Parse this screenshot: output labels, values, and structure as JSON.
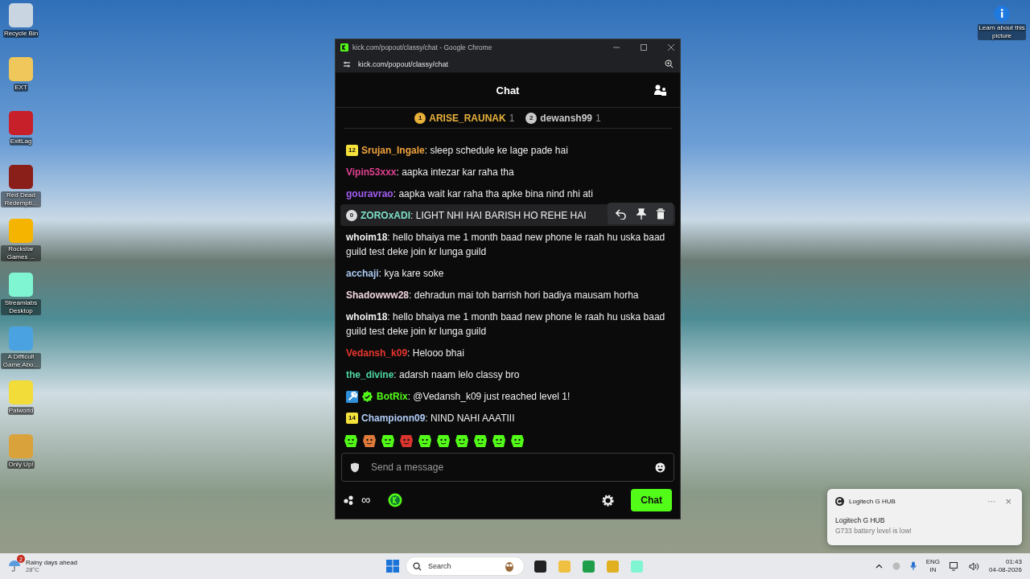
{
  "desktop_icons": [
    {
      "label": "Recycle Bin",
      "color": "#c9d6e2"
    },
    {
      "label": "EXT",
      "color": "#f0c75a"
    },
    {
      "label": "ExitLag",
      "color": "#c8202a"
    },
    {
      "label": "Red Dead Redempti...",
      "color": "#8a1f1a"
    },
    {
      "label": "Rockstar Games ...",
      "color": "#f5b400"
    },
    {
      "label": "Streamlabs Desktop",
      "color": "#80f5d2"
    },
    {
      "label": "A Difficult Game Abo...",
      "color": "#4aa3e0"
    },
    {
      "label": "Palworld",
      "color": "#f2dc3a"
    },
    {
      "label": "Only Up!",
      "color": "#d9a23a"
    }
  ],
  "learn_picture": {
    "label": "Learn about this picture"
  },
  "browser": {
    "title": "kick.com/popout/classy/chat - Google Chrome",
    "url": "kick.com/popout/classy/chat"
  },
  "chat": {
    "title": "Chat",
    "leaderboard": [
      {
        "rank": "1",
        "name": "ARISE_RAUNAK",
        "count": "1",
        "color": "#e8b23a"
      },
      {
        "rank": "2",
        "name": "dewansh99",
        "count": "1",
        "color": "#c9c9c9"
      }
    ],
    "messages": [
      {
        "badges": [
          {
            "kind": "subscriber",
            "text": "12"
          }
        ],
        "user": "Srujan_Ingale",
        "separator": ":",
        "color": "#f0a23c",
        "text": "sleep schedule ke lage pade hai",
        "highlighted": false
      },
      {
        "user": "Vipin53xxx",
        "separator": ":",
        "color": "#e0408f",
        "text": "aapka intezar kar raha tha",
        "highlighted": false
      },
      {
        "user": "gouravrao",
        "separator": ":",
        "color": "#a25cf0",
        "text": "aapka wait kar raha tha apke bina nind nhi ati",
        "highlighted": false
      },
      {
        "badges": [
          {
            "kind": "level",
            "text": "0"
          }
        ],
        "user": "ZOROxADI",
        "separator": ":",
        "color": "#7ee0c8",
        "text": "LIGHT NHI HAI BARISH HO REHE HAI",
        "highlighted": true
      },
      {
        "user": "whoim18",
        "separator": ":",
        "color": "#f2f2f2",
        "text": "hello bhaiya me 1 month baad new phone le raah hu uska baad guild test deke join kr lunga guild",
        "highlighted": false
      },
      {
        "user": "acchaji",
        "separator": ":",
        "color": "#a9c8ee",
        "text": "kya kare soke",
        "highlighted": false
      },
      {
        "user": "Shadowww28",
        "separator": ":",
        "color": "#f0d6dc",
        "text": "dehradun mai toh barrish hori badiya mausam horha",
        "highlighted": false
      },
      {
        "user": "whoim18",
        "separator": ":",
        "color": "#f2f2f2",
        "text": "hello bhaiya me 1 month baad new phone le raah hu uska baad guild test deke join kr lunga guild",
        "highlighted": false
      },
      {
        "user": "Vedansh_k09",
        "separator": ":",
        "color": "#e8352e",
        "text": "Helooo bhai",
        "highlighted": false
      },
      {
        "user": "the_divine",
        "separator": ":",
        "color": "#4fd6a0",
        "text": "adarsh naam lelo classy bro",
        "highlighted": false
      },
      {
        "badges": [
          {
            "kind": "moderator"
          },
          {
            "kind": "verified"
          }
        ],
        "user": "BotRix",
        "separator": ":",
        "color": "#53fc18",
        "text": "@Vedansh_k09 just reached level 1!",
        "highlighted": false
      },
      {
        "badges": [
          {
            "kind": "subscriber",
            "text": "14"
          }
        ],
        "user": "Championn09",
        "separator": ":",
        "color": "#b0ccf5",
        "text": "NIND NAHI AAATIII",
        "highlighted": false
      }
    ],
    "input": {
      "placeholder": "Send a message"
    },
    "footer": {
      "points": "∞",
      "send_button": "Chat"
    }
  },
  "notification": {
    "app": "Logitech G HUB",
    "title": "Logitech G HUB",
    "body": "G733 battery level is low!",
    "more": "···",
    "close": "×"
  },
  "taskbar": {
    "weather": {
      "title": "Rainy days ahead",
      "temp": "28°C",
      "badge": "2"
    },
    "search": "Search",
    "language": "ENG",
    "region": "IN",
    "time": "01:43",
    "date": "04-08-2026"
  }
}
